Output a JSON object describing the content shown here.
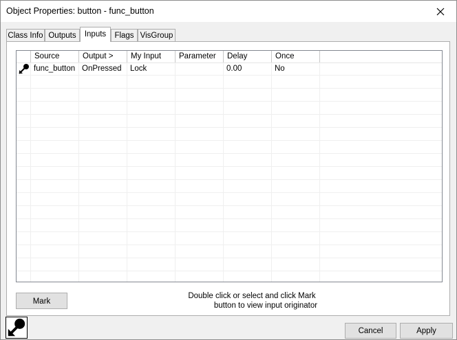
{
  "window": {
    "title": "Object Properties: button - func_button"
  },
  "tabs": [
    {
      "label": "Class Info"
    },
    {
      "label": "Outputs"
    },
    {
      "label": "Inputs"
    },
    {
      "label": "Flags"
    },
    {
      "label": "VisGroup"
    }
  ],
  "active_tab": "Inputs",
  "list": {
    "columns": [
      "Source",
      "Output  >",
      "My Input",
      "Parameter",
      "Delay",
      "Once"
    ],
    "rows": [
      {
        "icon": "arrow-icon",
        "source": "func_button",
        "output": "OnPressed",
        "my_input": "Lock",
        "parameter": "",
        "delay": "0.00",
        "once": "No"
      }
    ]
  },
  "mark_label": "Mark",
  "hint": {
    "line1": "Double click or select and click Mark",
    "line2": "button to view input originator"
  },
  "footer": {
    "cancel_label": "Cancel",
    "apply_label": "Apply"
  }
}
